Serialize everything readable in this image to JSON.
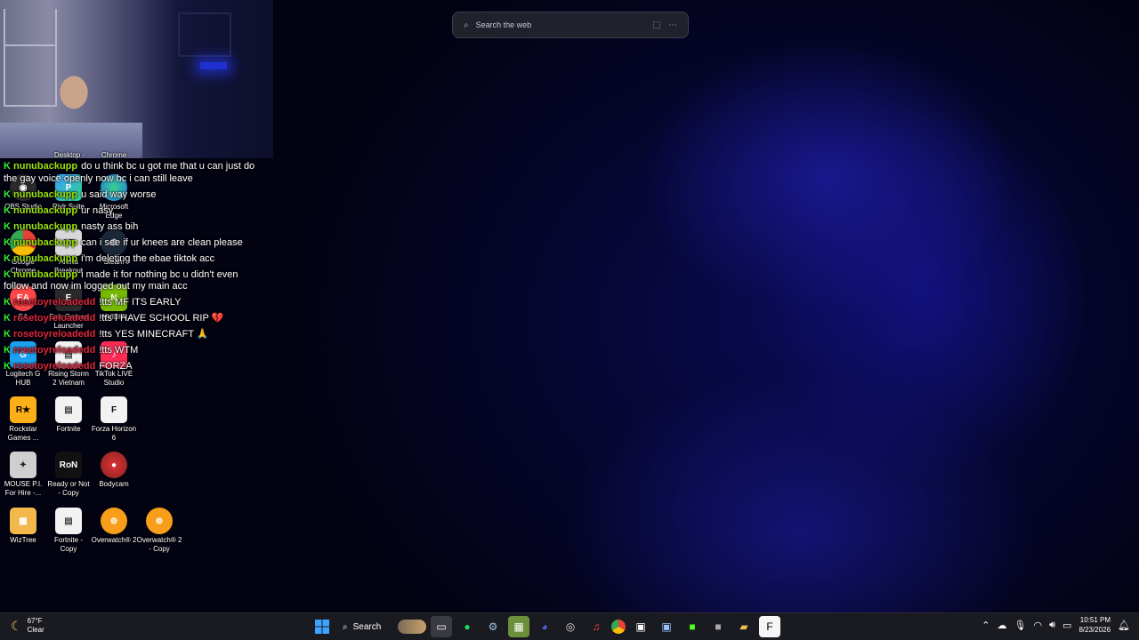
{
  "search_bar": {
    "placeholder": "Search the web"
  },
  "desktop_icons": [
    {
      "label": "Desktop -"
    },
    {
      "label": "Chrome"
    },
    {
      "label": "OBS Studio"
    },
    {
      "label": "Pixlr Suite"
    },
    {
      "label": "Microsoft Edge"
    },
    {
      "label": "Google Chrome"
    },
    {
      "label": "Arena Breakout"
    },
    {
      "label": "Steam"
    },
    {
      "label": "EA"
    },
    {
      "label": "Epic Games Launcher"
    },
    {
      "label": "NVIDIA"
    },
    {
      "label": "Logitech G HUB"
    },
    {
      "label": "Rising Storm 2 Vietnam"
    },
    {
      "label": "TikTok LIVE Studio"
    },
    {
      "label": "Rockstar Games ..."
    },
    {
      "label": "Fortnite"
    },
    {
      "label": "Forza Horizon 6"
    },
    {
      "label": "MOUSE P.I. For Hire -..."
    },
    {
      "label": "Ready or Not - Copy"
    },
    {
      "label": "Bodycam"
    },
    {
      "label": "WizTree"
    },
    {
      "label": "Fortnite - Copy"
    },
    {
      "label": "Overwatch® 2"
    },
    {
      "label": "Overwatch® 2 - Copy"
    }
  ],
  "chat": [
    {
      "user": "nunubackupp",
      "color": "#9be00e",
      "text": "do u think bc u got me that u can just do the gay voice openly now bc i can still leave"
    },
    {
      "user": "nunubackupp",
      "color": "#9be00e",
      "text": "u said way worse"
    },
    {
      "user": "nunubackupp",
      "color": "#9be00e",
      "text": "ur nasy"
    },
    {
      "user": "nunubackupp",
      "color": "#9be00e",
      "text": "nasty ass bih"
    },
    {
      "user": "nunubackupp",
      "color": "#9be00e",
      "text": "can i see if ur knees are clean please"
    },
    {
      "user": "nunubackupp",
      "color": "#9be00e",
      "text": "i'm deleting the ebae tiktok acc"
    },
    {
      "user": "nunubackupp",
      "color": "#9be00e",
      "text": "i made it for nothing bc u didn't even follow and now im logged out my main acc"
    },
    {
      "user": "rosetoyreloadedd",
      "color": "#e0263c",
      "text": "!tts MF ITS EARLY"
    },
    {
      "user": "rosetoyreloadedd",
      "color": "#e0263c",
      "text": "!tts I HAVE SCHOOL RIP 💔"
    },
    {
      "user": "rosetoyreloadedd",
      "color": "#e0263c",
      "text": "!tts YES MINECRAFT 🙏"
    },
    {
      "user": "rosetoyreloadedd",
      "color": "#e0263c",
      "text": "!tts WTM"
    },
    {
      "user": "rosetoyreloadedd",
      "color": "#e0263c",
      "text": "FORZA"
    }
  ],
  "taskbar": {
    "weather_temp": "67°F",
    "weather_desc": "Clear",
    "search_label": "Search",
    "time": "10:51 PM",
    "date": "8/23/2026"
  }
}
